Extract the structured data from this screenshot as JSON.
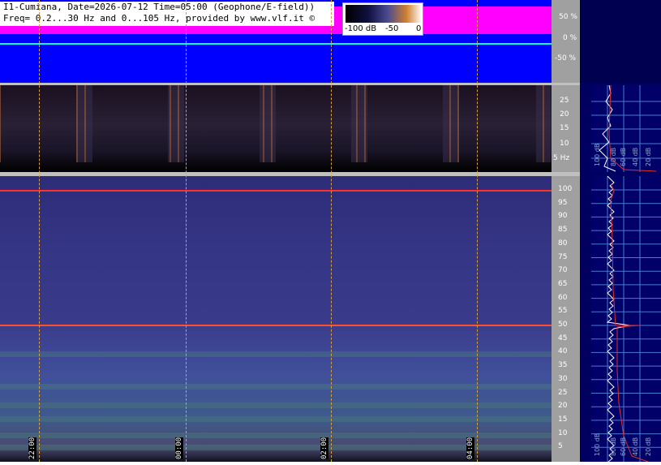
{
  "header": {
    "line1": "I1-Cumiana, Date=2026-07-12 Time=05:00 (Geophone/E-field))",
    "line2": "Freq= 0.2...30 Hz and 0...105 Hz, provided by www.vlf.it ©"
  },
  "colorbar": {
    "labels": [
      "-100 dB",
      "-50",
      "0"
    ]
  },
  "level_axis": {
    "labels": [
      "50 %",
      "0 %",
      "-50 %"
    ]
  },
  "freq_axis_low": {
    "labels": [
      "25",
      "20",
      "15",
      "10",
      "5 Hz"
    ]
  },
  "freq_axis_high": {
    "labels": [
      "100",
      "95",
      "90",
      "85",
      "80",
      "75",
      "70",
      "65",
      "60",
      "55",
      "50",
      "45",
      "40",
      "35",
      "30",
      "25",
      "20",
      "15",
      "10",
      "5"
    ]
  },
  "time_markers": [
    "22:00",
    "00:00",
    "02:00",
    "04:00"
  ],
  "spectrum_panel_low": {
    "db_labels": [
      "100 dB",
      "80 dB",
      "60 dB",
      "40 dB",
      "20 dB"
    ]
  },
  "spectrum_panel_high": {
    "db_labels": [
      "100 dB",
      "80 dB",
      "60 dB",
      "40 dB",
      "20 dB"
    ]
  },
  "colors": {
    "level_bg": "#0000ff",
    "level_band": "#ff00ff",
    "level_zero": "#00ffff",
    "mains_line": "#ff2020",
    "marker": "#d8a040",
    "side_bg": "#000068"
  }
}
